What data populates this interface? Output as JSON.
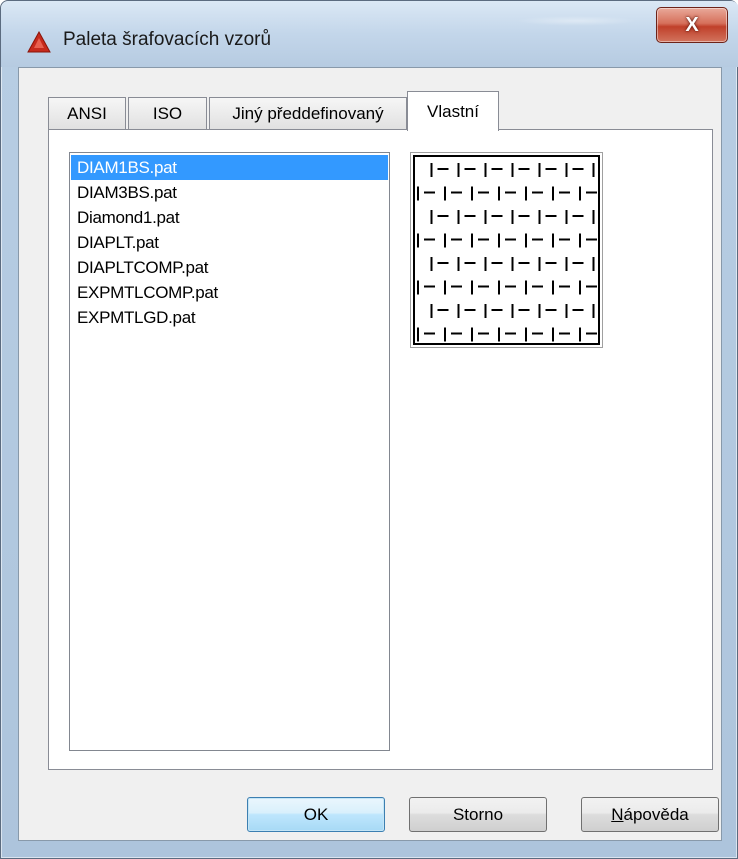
{
  "window": {
    "title": "Paleta šrafovacích vzorů",
    "close_glyph": "X",
    "app_icon": "autocad-triangle-icon",
    "accent_color": "#c0392b"
  },
  "tabs": [
    {
      "label": "ANSI",
      "active": false
    },
    {
      "label": "ISO",
      "active": false
    },
    {
      "label": "Jiný předdefinovaný",
      "active": false
    },
    {
      "label": "Vlastní",
      "active": true
    }
  ],
  "pattern_list": {
    "items": [
      "DIAM1BS.pat",
      "DIAM3BS.pat",
      "Diamond1.pat",
      "DIAPLT.pat",
      "DIAPLTCOMP.pat",
      "EXPMTLCOMP.pat",
      "EXPMTLGD.pat"
    ],
    "selected_index": 0,
    "selection_color": "#3399ff"
  },
  "preview": {
    "pattern": "DIAM1BS.pat"
  },
  "buttons": {
    "ok": "OK",
    "cancel": "Storno",
    "help_mnemonic": "N",
    "help_rest": "ápověda"
  }
}
